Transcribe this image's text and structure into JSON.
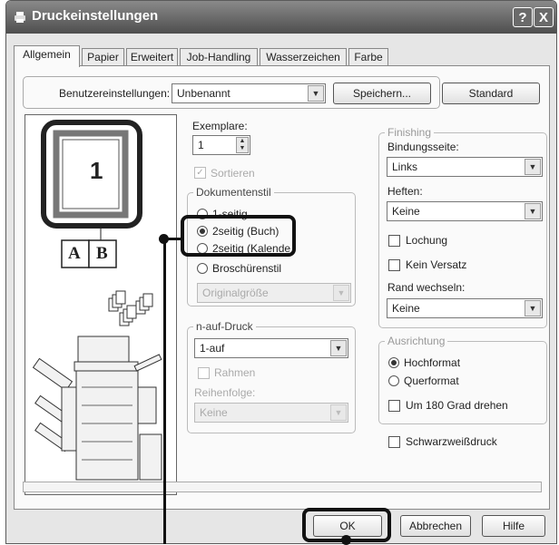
{
  "window": {
    "title": "Druckeinstellungen",
    "help_label": "?",
    "close_label": "X"
  },
  "tabs": [
    "Allgemein",
    "Papier",
    "Erweitert",
    "Job-Handling",
    "Wasserzeichen",
    "Farbe"
  ],
  "user_settings": {
    "label": "Benutzereinstellungen:",
    "value": "Unbenannt",
    "save_label": "Speichern...",
    "standard_label": "Standard"
  },
  "preview": {
    "page_number": "1",
    "booklet_left": "A",
    "booklet_right": "B"
  },
  "copies": {
    "label": "Exemplare:",
    "value": "1",
    "collate_label": "Sortieren"
  },
  "document_style": {
    "label": "Dokumentenstil",
    "options": [
      "1-seitig",
      "2seitig (Buch)",
      "2seitig (Kalende",
      "Broschürenstil"
    ],
    "selected_index": 1,
    "booklet_value": "Originalgröße"
  },
  "nup": {
    "label": "n-auf-Druck",
    "value": "1-auf",
    "border_label": "Rahmen",
    "order_label": "Reihenfolge:",
    "order_value": "Keine"
  },
  "finishing": {
    "label": "Finishing",
    "binding_label": "Bindungsseite:",
    "binding_value": "Links",
    "staple_label": "Heften:",
    "staple_value": "Keine",
    "punch_label": "Lochung",
    "no_offset_label": "Kein Versatz",
    "margin_label": "Rand wechseln:",
    "margin_value": "Keine"
  },
  "orientation": {
    "label": "Ausrichtung",
    "portrait_label": "Hochformat",
    "landscape_label": "Querformat",
    "selected": "portrait",
    "rotate_label": "Um 180 Grad drehen"
  },
  "bw_print_label": "Schwarzweißdruck",
  "footer": {
    "ok_label": "OK",
    "cancel_label": "Abbrechen",
    "help_label": "Hilfe"
  },
  "colors": {
    "titlebar_top": "#8a8a8a",
    "titlebar_bottom": "#4e4e4e",
    "callout": "#111111"
  }
}
